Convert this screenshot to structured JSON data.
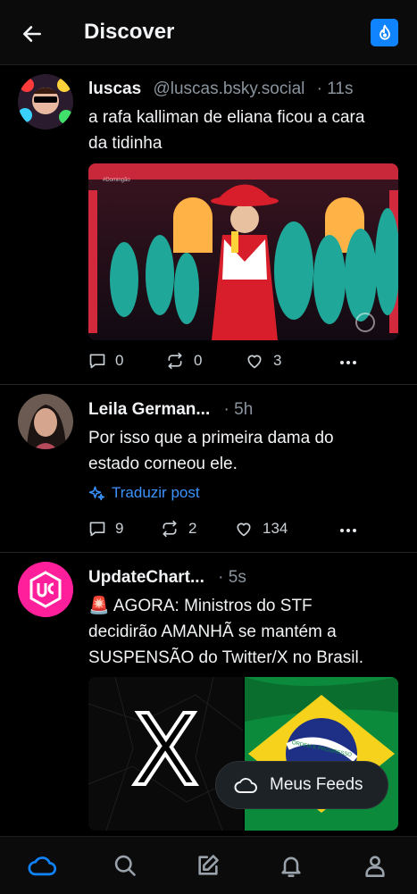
{
  "header": {
    "title": "Discover",
    "back_icon": "arrow-left-icon",
    "feed_icon": "flame-icon",
    "accent": "#1083fe"
  },
  "posts": [
    {
      "author": "luscas",
      "handle": "@luscas.bsky.social",
      "time": "· 11s",
      "text_lines": [
        "a rafa kalliman de eliana ficou a cara",
        "da tidinha"
      ],
      "replies": "0",
      "reposts": "0",
      "likes": "3",
      "image_overlay": "#Domingão"
    },
    {
      "author": "Leila German...",
      "time": "· 5h",
      "text_lines": [
        "Por isso que a primeira dama do",
        "estado corneou ele."
      ],
      "translate_label": "Traduzir post",
      "replies": "9",
      "reposts": "2",
      "likes": "134"
    },
    {
      "author": "UpdateChart...",
      "time": "· 5s",
      "text_lines": [
        "🚨 AGORA: Ministros do STF",
        "decidirão AMANHÃ se mantém a",
        "SUSPENSÃO do Twitter/X no Brasil."
      ],
      "image_left_text": "X",
      "flag_text": "ORDEM E PROGRESSO"
    }
  ],
  "fab": {
    "label": "Meus Feeds",
    "icon": "cloud-icon"
  },
  "nav": [
    "home-cloud-icon",
    "search-icon",
    "compose-icon",
    "bell-icon",
    "profile-icon"
  ]
}
